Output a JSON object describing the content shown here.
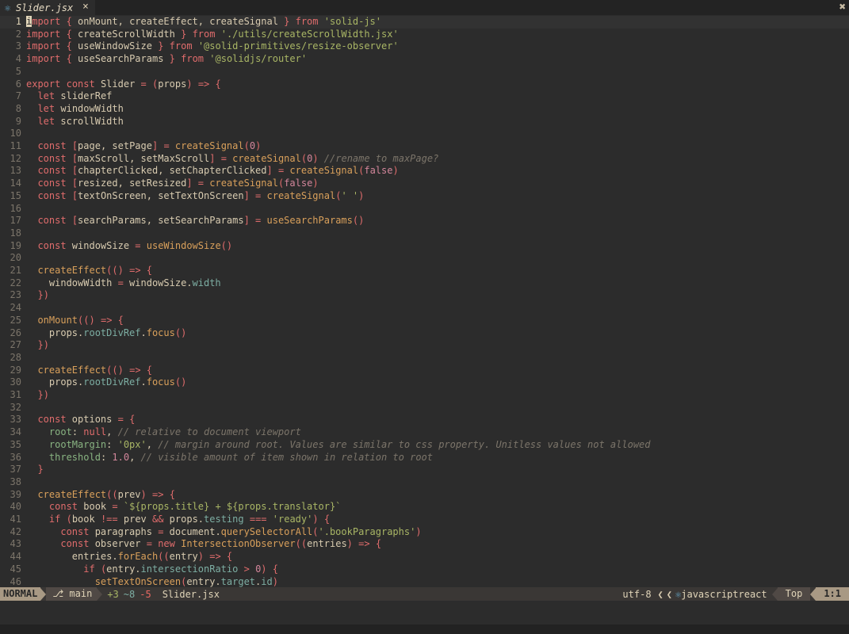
{
  "tab": {
    "file_icon": "react-atom-icon",
    "name": "Slider.jsx",
    "close": "×"
  },
  "window": {
    "close_all": "✖"
  },
  "editor": {
    "current_line": 1,
    "lines": [
      {
        "n": "1",
        "t": "import { onMount, createEffect, createSignal } from 'solid-js'"
      },
      {
        "n": "2",
        "t": "import { createScrollWidth } from './utils/createScrollWidth.jsx'"
      },
      {
        "n": "3",
        "t": "import { useWindowSize } from '@solid-primitives/resize-observer'"
      },
      {
        "n": "4",
        "t": "import { useSearchParams } from '@solidjs/router'"
      },
      {
        "n": "5",
        "t": ""
      },
      {
        "n": "6",
        "t": "export const Slider = (props) => {"
      },
      {
        "n": "7",
        "t": "  let sliderRef"
      },
      {
        "n": "8",
        "t": "  let windowWidth"
      },
      {
        "n": "9",
        "t": "  let scrollWidth"
      },
      {
        "n": "10",
        "t": ""
      },
      {
        "n": "11",
        "t": "  const [page, setPage] = createSignal(0)"
      },
      {
        "n": "12",
        "t": "  const [maxScroll, setMaxScroll] = createSignal(0) //rename to maxPage?"
      },
      {
        "n": "13",
        "t": "  const [chapterClicked, setChapterClicked] = createSignal(false)"
      },
      {
        "n": "14",
        "t": "  const [resized, setResized] = createSignal(false)"
      },
      {
        "n": "15",
        "t": "  const [textOnScreen, setTextOnScreen] = createSignal(' ')"
      },
      {
        "n": "16",
        "t": ""
      },
      {
        "n": "17",
        "t": "  const [searchParams, setSearchParams] = useSearchParams()"
      },
      {
        "n": "18",
        "t": ""
      },
      {
        "n": "19",
        "t": "  const windowSize = useWindowSize()"
      },
      {
        "n": "20",
        "t": ""
      },
      {
        "n": "21",
        "t": "  createEffect(() => {"
      },
      {
        "n": "22",
        "t": "    windowWidth = windowSize.width"
      },
      {
        "n": "23",
        "t": "  })"
      },
      {
        "n": "24",
        "t": ""
      },
      {
        "n": "25",
        "t": "  onMount(() => {"
      },
      {
        "n": "26",
        "t": "    props.rootDivRef.focus()"
      },
      {
        "n": "27",
        "t": "  })"
      },
      {
        "n": "28",
        "t": ""
      },
      {
        "n": "29",
        "t": "  createEffect(() => {"
      },
      {
        "n": "30",
        "t": "    props.rootDivRef.focus()"
      },
      {
        "n": "31",
        "t": "  })"
      },
      {
        "n": "32",
        "t": ""
      },
      {
        "n": "33",
        "t": "  const options = {"
      },
      {
        "n": "34",
        "t": "    root: null, // relative to document viewport"
      },
      {
        "n": "35",
        "t": "    rootMargin: '0px', // margin around root. Values are similar to css property. Unitless values not allowed"
      },
      {
        "n": "36",
        "t": "    threshold: 1.0, // visible amount of item shown in relation to root"
      },
      {
        "n": "37",
        "t": "  }"
      },
      {
        "n": "38",
        "t": ""
      },
      {
        "n": "39",
        "t": "  createEffect((prev) => {"
      },
      {
        "n": "40",
        "t": "    const book = `${props.title} + ${props.translator}`"
      },
      {
        "n": "41",
        "t": "    if (book !== prev && props.testing === 'ready') {"
      },
      {
        "n": "42",
        "t": "      const paragraphs = document.querySelectorAll('.bookParagraphs')"
      },
      {
        "n": "43",
        "t": "      const observer = new IntersectionObserver((entries) => {"
      },
      {
        "n": "44",
        "t": "        entries.forEach((entry) => {"
      },
      {
        "n": "45",
        "t": "          if (entry.intersectionRatio > 0) {"
      },
      {
        "n": "46",
        "t": "            setTextOnScreen(entry.target.id)"
      }
    ]
  },
  "statusline": {
    "mode": "NORMAL",
    "branch_icon": "git-branch-icon",
    "branch": "main",
    "diff_added": "+3",
    "diff_modified": "~8",
    "diff_removed": "-5",
    "file": "Slider.jsx",
    "encoding": "utf-8",
    "filetype_icon": "react-atom-icon",
    "filetype": "javascriptreact",
    "scroll": "Top",
    "position": "1:1"
  },
  "colors": {
    "background": "#2c2c2c",
    "keyword": "#e06c6c",
    "function": "#d9a05b",
    "string": "#a9b665",
    "comment": "#7c756a",
    "number": "#d3869b",
    "property": "#89b482",
    "mode_bg": "#a89984"
  }
}
